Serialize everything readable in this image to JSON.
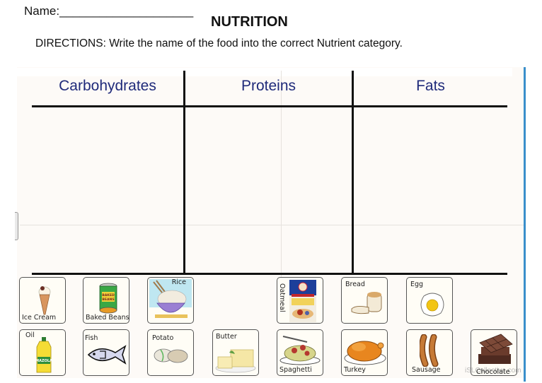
{
  "header": {
    "name_label": "Name:____________________",
    "title": "NUTRITION",
    "directions": "DIRECTIONS: Write the name of the food into the correct Nutrient category."
  },
  "table": {
    "columns": [
      {
        "label": "Carbohydrates"
      },
      {
        "label": "Proteins"
      },
      {
        "label": "Fats"
      }
    ]
  },
  "foods": {
    "row1": [
      {
        "label": "Ice Cream",
        "icon": "ice-cream-icon"
      },
      {
        "label": "Baked Beans",
        "icon": "baked-beans-can-icon",
        "can_text": "BAKED BEANS"
      },
      {
        "label": "Rice",
        "icon": "rice-bowl-icon"
      },
      {
        "label": "Oatmeal",
        "icon": "oatmeal-box-icon"
      },
      {
        "label": "Bread",
        "icon": "bread-icon"
      },
      {
        "label": "Egg",
        "icon": "egg-icon"
      }
    ],
    "row2": [
      {
        "label": "Oil",
        "icon": "oil-bottle-icon"
      },
      {
        "label": "Fish",
        "icon": "fish-icon"
      },
      {
        "label": "Potato",
        "icon": "potato-icon"
      },
      {
        "label": "Butter",
        "icon": "butter-icon"
      },
      {
        "label": "Spaghetti",
        "icon": "spaghetti-icon"
      },
      {
        "label": "Turkey",
        "icon": "turkey-icon"
      },
      {
        "label": "Sausage",
        "icon": "sausage-icon"
      },
      {
        "label": "Chocolate",
        "icon": "chocolate-icon"
      }
    ]
  },
  "watermark": "iSLCollective.com",
  "colors": {
    "header_text": "#1f2a7a",
    "right_border": "#3a8fcb"
  }
}
